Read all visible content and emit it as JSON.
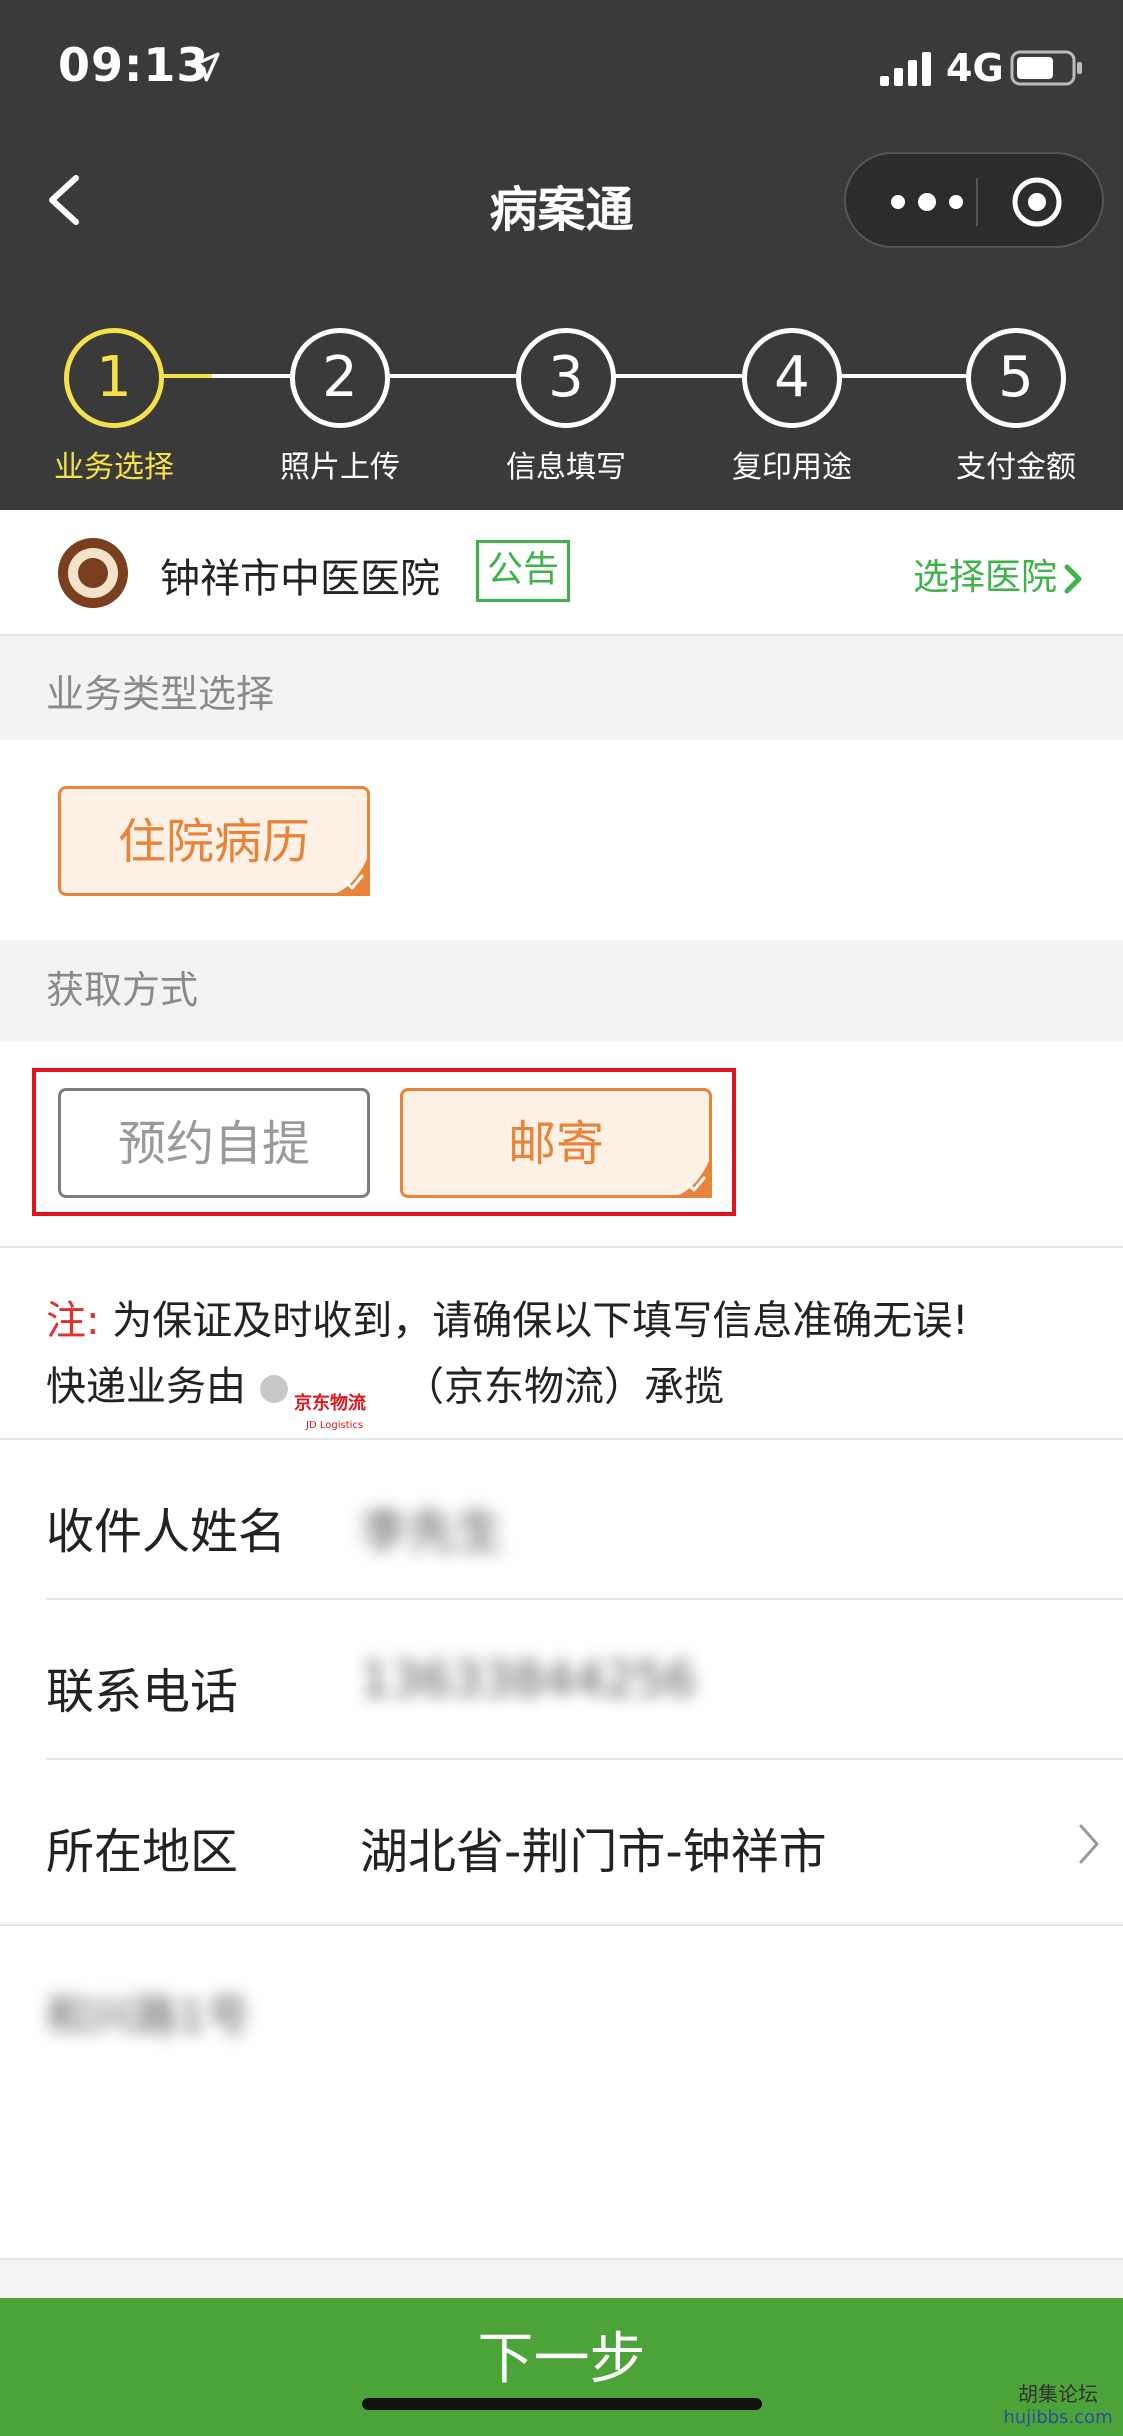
{
  "status_bar": {
    "time": "09:13",
    "network": "4G"
  },
  "nav": {
    "title": "病案通"
  },
  "steps": [
    {
      "num": "1",
      "label": "业务选择",
      "active": true
    },
    {
      "num": "2",
      "label": "照片上传",
      "active": false
    },
    {
      "num": "3",
      "label": "信息填写",
      "active": false
    },
    {
      "num": "4",
      "label": "复印用途",
      "active": false
    },
    {
      "num": "5",
      "label": "支付金额",
      "active": false
    }
  ],
  "hospital": {
    "name": "钟祥市中医医院",
    "notice_tag": "公告",
    "choose_label": "选择医院"
  },
  "business_section": {
    "title": "业务类型选择",
    "options": [
      {
        "label": "住院病历",
        "selected": true
      }
    ]
  },
  "method_section": {
    "title": "获取方式",
    "options": [
      {
        "label": "预约自提",
        "selected": false
      },
      {
        "label": "邮寄",
        "selected": true
      }
    ]
  },
  "note": {
    "prefix": "注:",
    "line1": "为保证及时收到，请确保以下填写信息准确无误!",
    "line2_before": "快递业务由",
    "jd_logo_text": "京东物流",
    "jd_logo_sub": "JD Logistics",
    "line2_after": "（京东物流）承揽"
  },
  "form": {
    "recipient_label": "收件人姓名",
    "recipient_value": "李先生",
    "phone_label": "联系电话",
    "phone_value": "13633844256",
    "region_label": "所在地区",
    "region_value": "湖北省-荆门市-钟祥市"
  },
  "address": {
    "value": "和兴路1号"
  },
  "next_button": {
    "label": "下一步"
  },
  "watermark": {
    "title": "胡集论坛",
    "site": "hujibbs.com"
  },
  "colors": {
    "header_bg": "#3a3a3a",
    "active_step": "#f5e14a",
    "accent_green": "#4ca337",
    "selected_orange": "#e8843a",
    "highlight_red": "#e3141b"
  }
}
